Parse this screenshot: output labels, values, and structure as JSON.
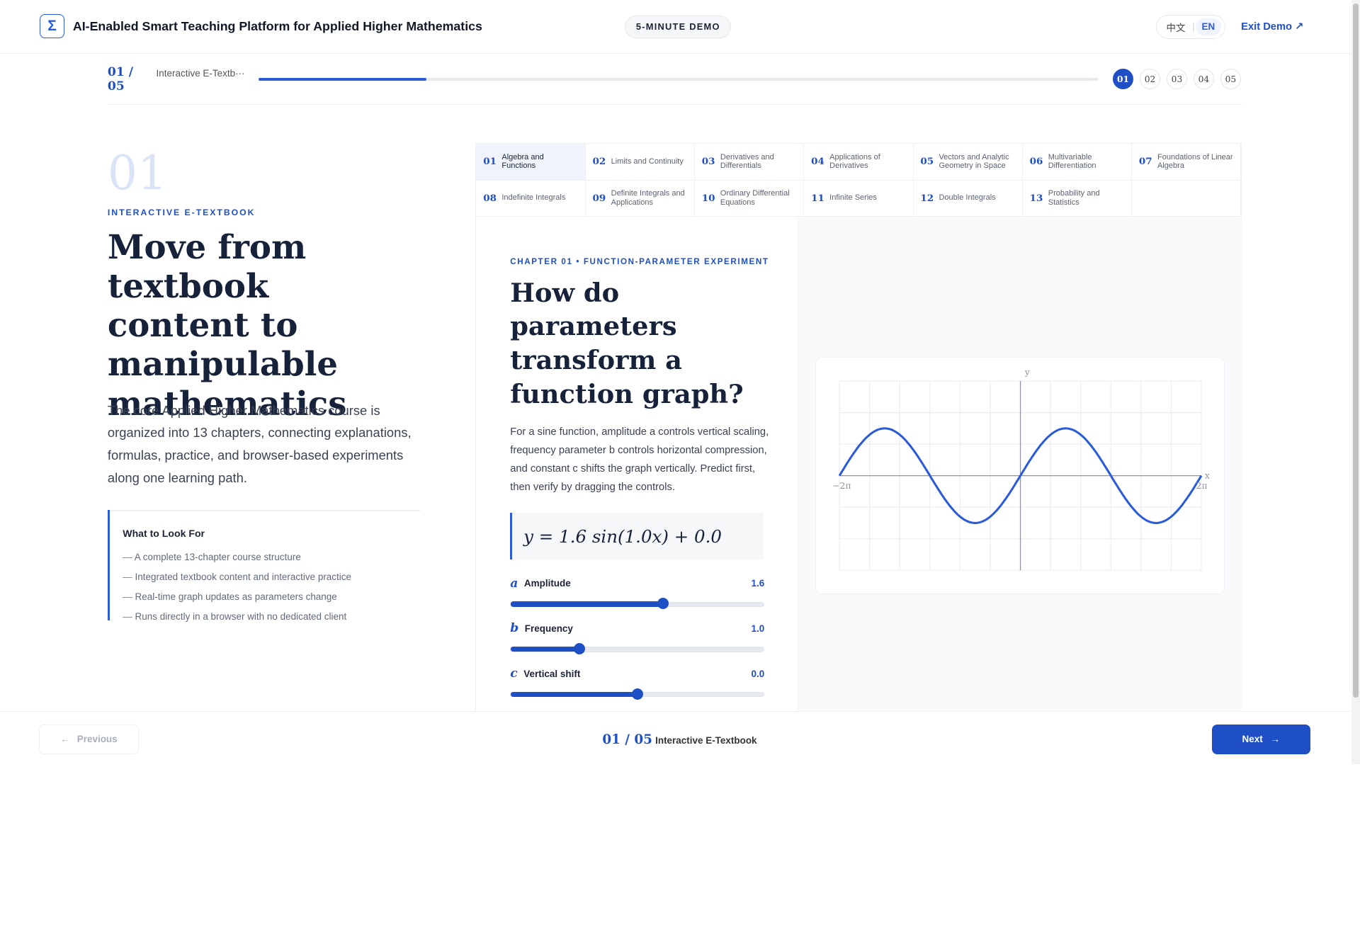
{
  "header": {
    "logo_glyph": "Σ",
    "title": "AI-Enabled Smart Teaching Platform for Applied Higher Mathematics",
    "badge": "5-MINUTE DEMO",
    "lang_zh": "中文",
    "lang_sep": "|",
    "lang_en": "EN",
    "exit": "Exit Demo ↗"
  },
  "progress": {
    "step": "01 /",
    "total": "05",
    "name": "Interactive E-Textb···",
    "fraction": 0.2,
    "dots": [
      "01",
      "02",
      "03",
      "04",
      "05"
    ]
  },
  "intro": {
    "number": "01",
    "eyebrow": "INTERACTIVE E-TEXTBOOK",
    "headline": "Move from textbook content to manipulable mathematics",
    "description": "The core Applied Higher Mathematics course is organized into 13 chapters, connecting explanations, formulas, practice, and browser-based experiments along one learning path.",
    "look_title": "What to Look For",
    "look_items": [
      "A complete 13-chapter course structure",
      "Integrated textbook content and interactive practice",
      "Real-time graph updates as parameters change",
      "Runs directly in a browser with no dedicated client"
    ]
  },
  "chapters": [
    {
      "n": "01",
      "t": "Algebra and Functions"
    },
    {
      "n": "02",
      "t": "Limits and Continuity"
    },
    {
      "n": "03",
      "t": "Derivatives and Differentials"
    },
    {
      "n": "04",
      "t": "Applications of Derivatives"
    },
    {
      "n": "05",
      "t": "Vectors and Analytic Geometry in Space"
    },
    {
      "n": "06",
      "t": "Multivariable Differentiation"
    },
    {
      "n": "07",
      "t": "Foundations of Linear Algebra"
    },
    {
      "n": "08",
      "t": "Indefinite Integrals"
    },
    {
      "n": "09",
      "t": "Definite Integrals and Applications"
    },
    {
      "n": "10",
      "t": "Ordinary Differential Equations"
    },
    {
      "n": "11",
      "t": "Infinite Series"
    },
    {
      "n": "12",
      "t": "Double Integrals"
    },
    {
      "n": "13",
      "t": "Probability and Statistics"
    }
  ],
  "experiment": {
    "chapter_label": "CHAPTER 01 • FUNCTION-PARAMETER EXPERIMENT",
    "question": "How do parameters transform a function graph?",
    "description": "For a sine function, amplitude a controls vertical scaling, frequency parameter b controls horizontal compression, and constant c shifts the graph vertically. Predict first, then verify by dragging the controls.",
    "formula": "y = 1.6 sin(1.0x) + 0.0",
    "sliders": [
      {
        "sym": "a",
        "label": "Amplitude",
        "value": "1.6",
        "fraction": 0.6
      },
      {
        "sym": "b",
        "label": "Frequency",
        "value": "1.0",
        "fraction": 0.27
      },
      {
        "sym": "c",
        "label": "Vertical shift",
        "value": "0.0",
        "fraction": 0.5
      }
    ]
  },
  "graph": {
    "y_label": "y",
    "x_label": "x",
    "x_min_label": "−2π",
    "x_max_label": "2π",
    "color": "#2b5bd7"
  },
  "chart_data": {
    "type": "line",
    "title": "",
    "xlabel": "x",
    "ylabel": "y",
    "xlim": [
      -6.2832,
      6.2832
    ],
    "ylim": [
      -3.2,
      3.2
    ],
    "series": [
      {
        "a": 1.6,
        "b": 1.0,
        "c": 0.0
      }
    ]
  },
  "footer": {
    "previous": "Previous",
    "prev_arrow": "←",
    "step": "01 / 05",
    "name": "Interactive E-Textbook",
    "next": "Next",
    "next_arrow": "→"
  },
  "colors": {
    "accent": "#1f4fc4",
    "accent_light": "#eef3fc"
  }
}
